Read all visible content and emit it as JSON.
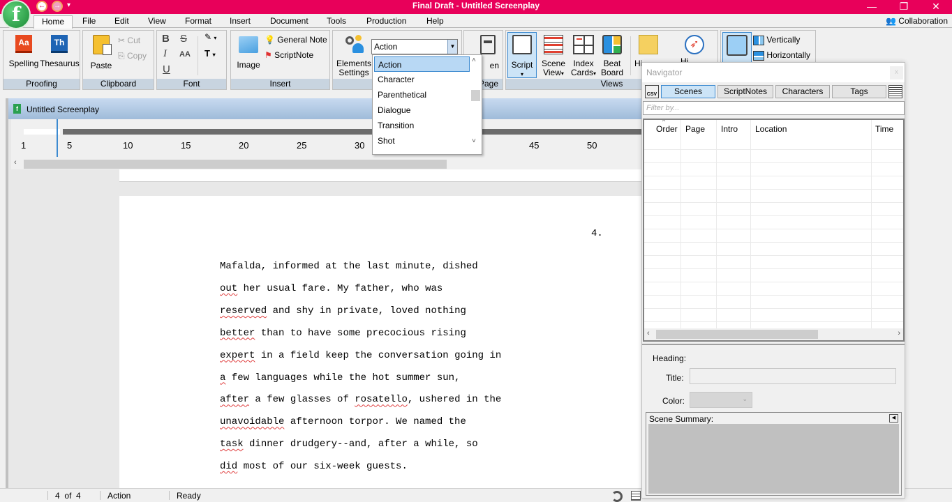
{
  "app": {
    "title": "Final Draft - Untitled Screenplay",
    "logo_letter": "f",
    "quick_access": {
      "back_icon": "back-arrow-icon",
      "forward_icon": "forward-arrow-icon",
      "customize": "▾"
    },
    "window_controls": {
      "minimize": "—",
      "restore": "❐",
      "close": "✕"
    }
  },
  "menu": {
    "tabs": [
      "Home",
      "File",
      "Edit",
      "View",
      "Format",
      "Insert",
      "Document",
      "Tools",
      "Production",
      "Help"
    ],
    "active": "Home",
    "collaboration": "Collaboration"
  },
  "ribbon": {
    "proofing": {
      "label": "Proofing",
      "spelling": "Spelling",
      "thesaurus": "Thesaurus",
      "spelling_glyph": "Aa",
      "thesaurus_glyph": "Th"
    },
    "clipboard": {
      "label": "Clipboard",
      "paste": "Paste",
      "cut": "Cut",
      "copy": "Copy"
    },
    "font": {
      "label": "Font",
      "bold": "B",
      "strike": "S",
      "italic": "I",
      "case": "AA",
      "underline": "U",
      "text_color": "T"
    },
    "insert": {
      "label": "Insert",
      "image": "Image",
      "general_note": "General Note",
      "scriptnote": "ScriptNote"
    },
    "elements": {
      "label": "S",
      "settings_line1": "Elements",
      "settings_line2": "Settings",
      "selected": "Action",
      "options": [
        "Action",
        "Character",
        "Parenthetical",
        "Dialogue",
        "Transition",
        "Shot"
      ]
    },
    "page": {
      "label": "Page",
      "partial_button": "en"
    },
    "views": {
      "label": "Views",
      "script": "Script",
      "scene_line1": "Scene",
      "scene_line2": "View",
      "index_line1": "Index",
      "index_line2": "Cards",
      "beat_line1": "Beat",
      "beat_line2": "Board",
      "partial1": "Hi",
      "partial2": "Hi"
    },
    "split": {
      "vertically": "Vertically",
      "horizontally": "Horizontally"
    }
  },
  "document": {
    "window_title": "Untitled Screenplay",
    "ruler_ticks": [
      "1",
      "5",
      "10",
      "15",
      "20",
      "25",
      "30",
      "45",
      "50"
    ],
    "page_number": "4.",
    "lines": [
      [
        {
          "t": "Mafalda, informed at the last minute, dished"
        }
      ],
      [
        {
          "t": "out",
          "sq": true
        },
        {
          "t": " her usual fare. My father, who was"
        }
      ],
      [
        {
          "t": "reserved",
          "sq": true
        },
        {
          "t": " and shy in private, loved nothing"
        }
      ],
      [
        {
          "t": "better",
          "sq": true
        },
        {
          "t": " than to have some precocious rising"
        }
      ],
      [
        {
          "t": "expert",
          "sq": true
        },
        {
          "t": " in a field keep the conversation going in"
        }
      ],
      [
        {
          "t": "a",
          "sq": true
        },
        {
          "t": " few languages while the hot summer sun,"
        }
      ],
      [
        {
          "t": "after",
          "sq": true
        },
        {
          "t": " a few glasses of "
        },
        {
          "t": "rosatello",
          "sq": true
        },
        {
          "t": ", ushered in the"
        }
      ],
      [
        {
          "t": "unavoidable",
          "sq": true
        },
        {
          "t": " afternoon torpor. We named the"
        }
      ],
      [
        {
          "t": "task",
          "sq": true
        },
        {
          "t": " dinner drudgery--and, after a while, so"
        }
      ],
      [
        {
          "t": "did",
          "sq": true
        },
        {
          "t": " most of our six-week guests."
        }
      ]
    ]
  },
  "navigator": {
    "title": "Navigator",
    "close": "x",
    "csv_label": "CSV",
    "tabs": [
      "Scenes",
      "ScriptNotes",
      "Characters",
      "Tags"
    ],
    "active_tab": "Scenes",
    "filter_placeholder": "Filter by...",
    "columns": [
      "Order",
      "Page",
      "Intro",
      "Location",
      "Time"
    ],
    "sort_indicator": "^",
    "heading_label": "Heading:",
    "title_label": "Title:",
    "title_value": "",
    "color_label": "Color:",
    "scene_summary_label": "Scene Summary:"
  },
  "status": {
    "page": "4",
    "of": "of",
    "total": "4",
    "element": "Action",
    "state": "Ready"
  }
}
